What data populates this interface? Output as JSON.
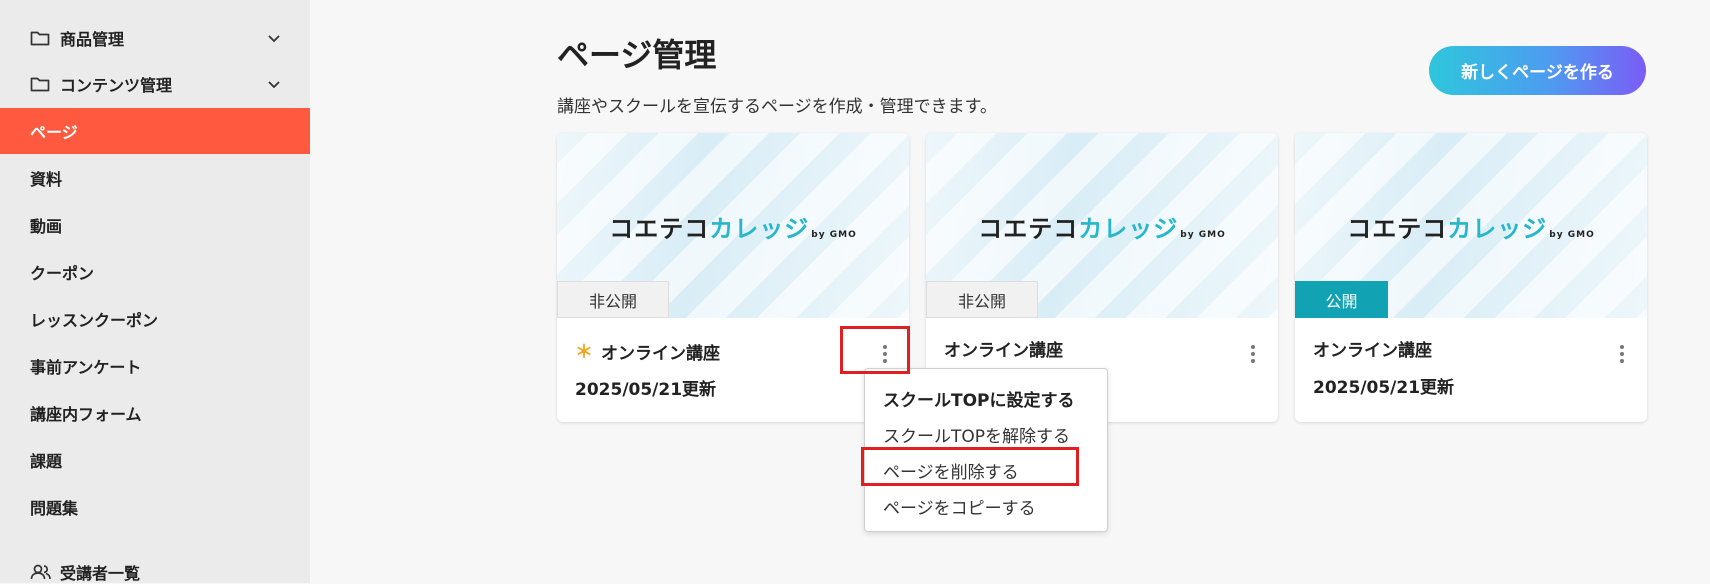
{
  "sidebar": {
    "groups": [
      {
        "label": "商品管理"
      },
      {
        "label": "コンテンツ管理"
      }
    ],
    "items": [
      {
        "label": "ページ",
        "active": true
      },
      {
        "label": "資料"
      },
      {
        "label": "動画"
      },
      {
        "label": "クーポン"
      },
      {
        "label": "レッスンクーポン"
      },
      {
        "label": "事前アンケート"
      },
      {
        "label": "講座内フォーム"
      },
      {
        "label": "課題"
      },
      {
        "label": "問題集"
      }
    ],
    "users_label": "受講者一覧"
  },
  "main": {
    "title": "ページ管理",
    "description": "講座やスクールを宣伝するページを作成・管理できます。",
    "new_button": "新しくページを作る"
  },
  "logo": {
    "part1": "コエテコ",
    "part2": "カレッジ",
    "part3": "by GMO"
  },
  "cards": [
    {
      "status": "非公開",
      "title": "オンライン講座",
      "star": "＊",
      "date": "2025/05/21更新"
    },
    {
      "status": "非公開",
      "title": "オンライン講座",
      "date": ""
    },
    {
      "status": "公開",
      "title": "オンライン講座",
      "date": "2025/05/21更新"
    }
  ],
  "menu": {
    "items": [
      "スクールTOPに設定する",
      "スクールTOPを解除する",
      "ページを削除する",
      "ページをコピーする"
    ]
  },
  "colors": {
    "active_nav": "#ff5a3f",
    "public_badge": "#11a3b3",
    "highlight": "#e02020",
    "star": "#f4a61a"
  }
}
